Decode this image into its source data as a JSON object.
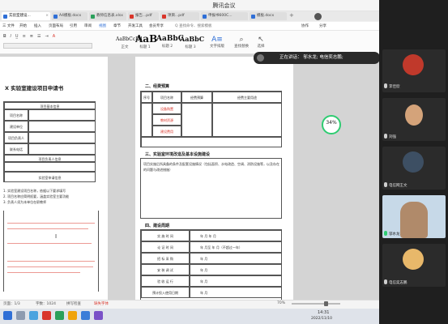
{
  "app": {
    "title": "腾讯会议"
  },
  "tabs": [
    {
      "label": "实验室建设...",
      "color": "#2f6fd6",
      "active": true
    },
    {
      "label": "A4模板.docx",
      "color": "#2f6fd6",
      "active": false
    },
    {
      "label": "教师信息表.xlsx",
      "color": "#2aa05b",
      "active": false
    },
    {
      "label": "报告...pdf",
      "color": "#d9352a",
      "active": false
    },
    {
      "label": "项目...pdf",
      "color": "#d9352a",
      "active": false
    },
    {
      "label": "申报书600C...",
      "color": "#2f6fd6",
      "active": false
    },
    {
      "label": "模板.docx",
      "color": "#2f6fd6",
      "active": false
    }
  ],
  "menu": [
    "三 文件",
    "开始",
    "插入",
    "页面布局",
    "引用",
    "审阅",
    "视图",
    "章节",
    "开发工具",
    "会员专享"
  ],
  "menu_right": [
    "Q 查找命令、搜索模板",
    "协作",
    "分享"
  ],
  "styles": [
    {
      "sample": "AaBbCcDd",
      "label": "正文"
    },
    {
      "sample": "AaB",
      "label": "标题 1"
    },
    {
      "sample": "AaBbC",
      "label": "标题 2"
    },
    {
      "sample": "AaBbC",
      "label": "标题 3"
    }
  ],
  "toolbar_right": [
    "文字排版",
    "查找替换",
    "选择"
  ],
  "speaking": "正在讲话：  邬水龙; 电信奕志鹏;",
  "progress": {
    "value": 34,
    "label": "34%"
  },
  "left_page": {
    "title": "X 实验室建设项目申请书",
    "rows": [
      "项目基本信息",
      "项目名称",
      "建设单位",
      "项目负责人",
      "联系电话",
      "项目负责人信息",
      "实验室申请信息"
    ],
    "red_lines": [
      "1. 实验室建设项目名称，依据以下要求填写",
      "2. 项目名称应简明扼要，涵盖实验室主要功能",
      "3. 负责人须为本单位在职教师"
    ]
  },
  "right_page": {
    "section2": "二、经费预算",
    "budget_headers": [
      "序号",
      "项目名称",
      "经费预算",
      "经费主要用途"
    ],
    "budget_items": [
      "设备购置",
      "教材资源",
      "建设费用"
    ],
    "section3": "三、实验室环境改造及基本设施建设",
    "section3_text": "项目实施后所具备的条件及配套设施情况（包括面积、水电改造、空调、消防设施等，以及存在的问题与改进措施）",
    "section4": "四、建设周期",
    "schedule": [
      {
        "label": "实 施 时 间",
        "text": "年  月     年  月"
      },
      {
        "label": "论 证 时 间",
        "text": "年  月至   年  月（不超过一年）"
      },
      {
        "label": "招 标 采 购",
        "text": "年  月"
      },
      {
        "label": "安 装 调 试",
        "text": "年  月"
      },
      {
        "label": "验 收 运 行",
        "text": "年  月"
      },
      {
        "label": "预计投入使用日期",
        "text": "年  月"
      }
    ]
  },
  "statusbar": {
    "page": "页面：1/3",
    "words": "字数：1024",
    "spell": "拼写检查",
    "font": "缺失字体",
    "zoom": "70%"
  },
  "clock": {
    "time": "14:31",
    "date": "2022/11/10"
  },
  "participants": [
    {
      "name": "李佳欣",
      "mic": true
    },
    {
      "name": "刘强",
      "mic": true
    },
    {
      "name": "电信网王文",
      "mic": true
    },
    {
      "name": "邬水龙",
      "mic": true
    },
    {
      "name": "电信奕志鹏",
      "mic": true
    }
  ]
}
